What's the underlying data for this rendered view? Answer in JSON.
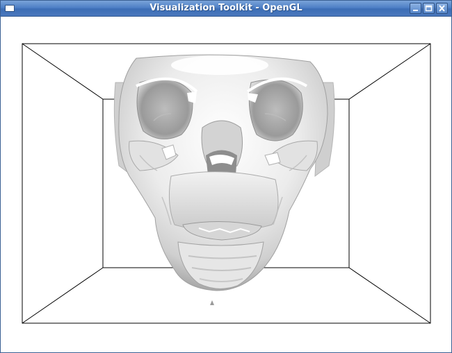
{
  "window": {
    "title": "Visualization Toolkit - OpenGL",
    "controls": [
      {
        "name": "minimize",
        "icon": "minimize-icon"
      },
      {
        "name": "maximize",
        "icon": "maximize-icon"
      },
      {
        "name": "close",
        "icon": "close-icon"
      }
    ],
    "titlebar_color": "#4f80c6",
    "background_color": "#ffffff"
  },
  "scene": {
    "object": "skull isosurface",
    "object_color": "#e6e6e6",
    "outline_color": "#000000"
  }
}
